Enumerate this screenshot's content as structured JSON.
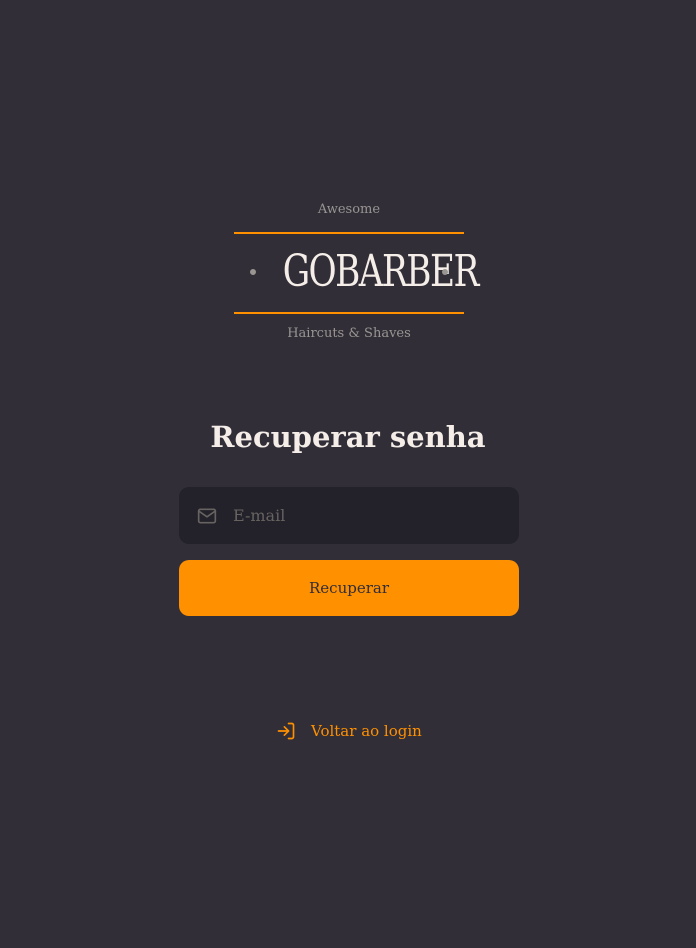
{
  "logo": {
    "tagline_top": "Awesome",
    "brand": "GOBARBER",
    "tagline_bottom": "Haircuts & Shaves"
  },
  "page": {
    "title": "Recuperar senha"
  },
  "form": {
    "email_placeholder": "E-mail",
    "email_value": "",
    "submit_label": "Recuperar"
  },
  "back_link": {
    "label": "Voltar ao login",
    "icon": "log-in-icon"
  },
  "colors": {
    "background": "#312E38",
    "accent": "#FF9000",
    "input_bg": "#232129",
    "muted": "#999591",
    "placeholder": "#666360",
    "text": "#F4EDE8"
  }
}
